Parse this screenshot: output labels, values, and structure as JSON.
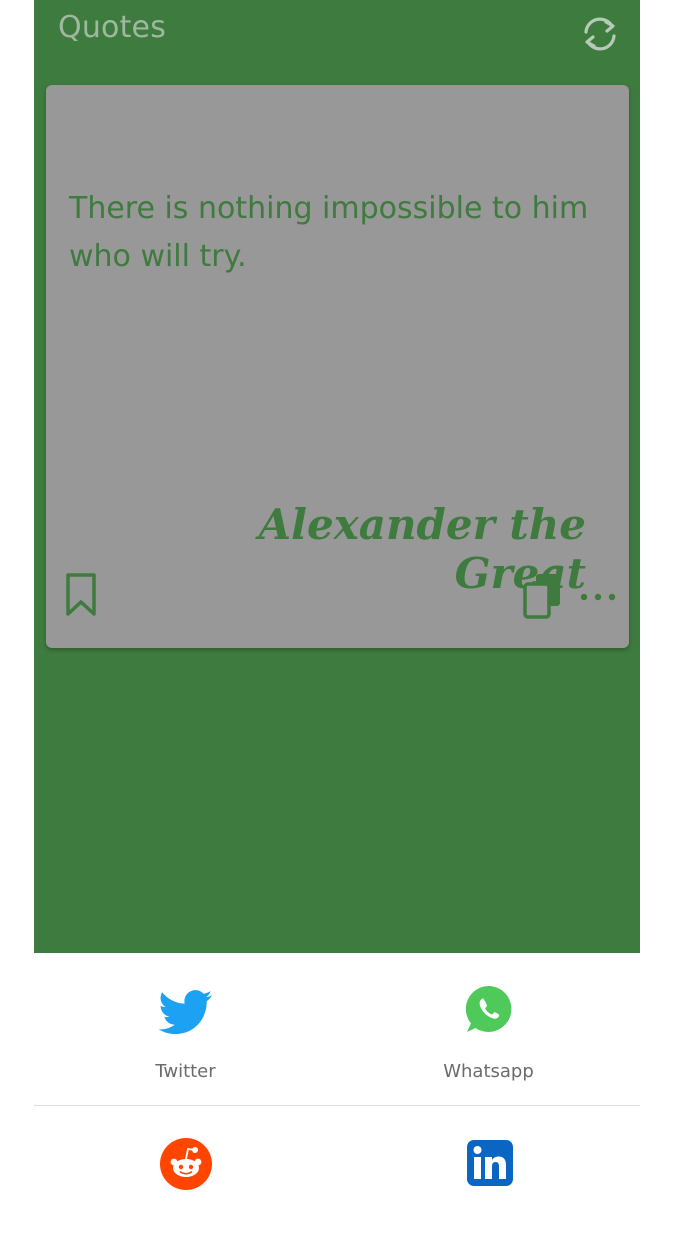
{
  "header": {
    "title": "Quotes",
    "refresh_icon": "refresh-icon"
  },
  "card": {
    "quote": "There is nothing impossible to him who will try.",
    "author": "Alexander the Great",
    "icons": [
      "bookmark-icon",
      "copy-icon",
      "more-icon"
    ]
  },
  "share": {
    "items": [
      {
        "label": "Twitter",
        "icon": "twitter-icon"
      },
      {
        "label": "Whatsapp",
        "icon": "whatsapp-icon"
      },
      {
        "label": "",
        "icon": "reddit-icon"
      },
      {
        "label": "",
        "icon": "linkedin-icon"
      }
    ]
  },
  "colors": {
    "app_green": "#3e7b3e",
    "card_gray": "#989898",
    "text_green": "#3f7a3f",
    "twitter_blue": "#1da1f2",
    "whatsapp_green": "#4ec95a",
    "reddit_orange": "#ff4500",
    "linkedin_blue": "#0a66c2"
  }
}
